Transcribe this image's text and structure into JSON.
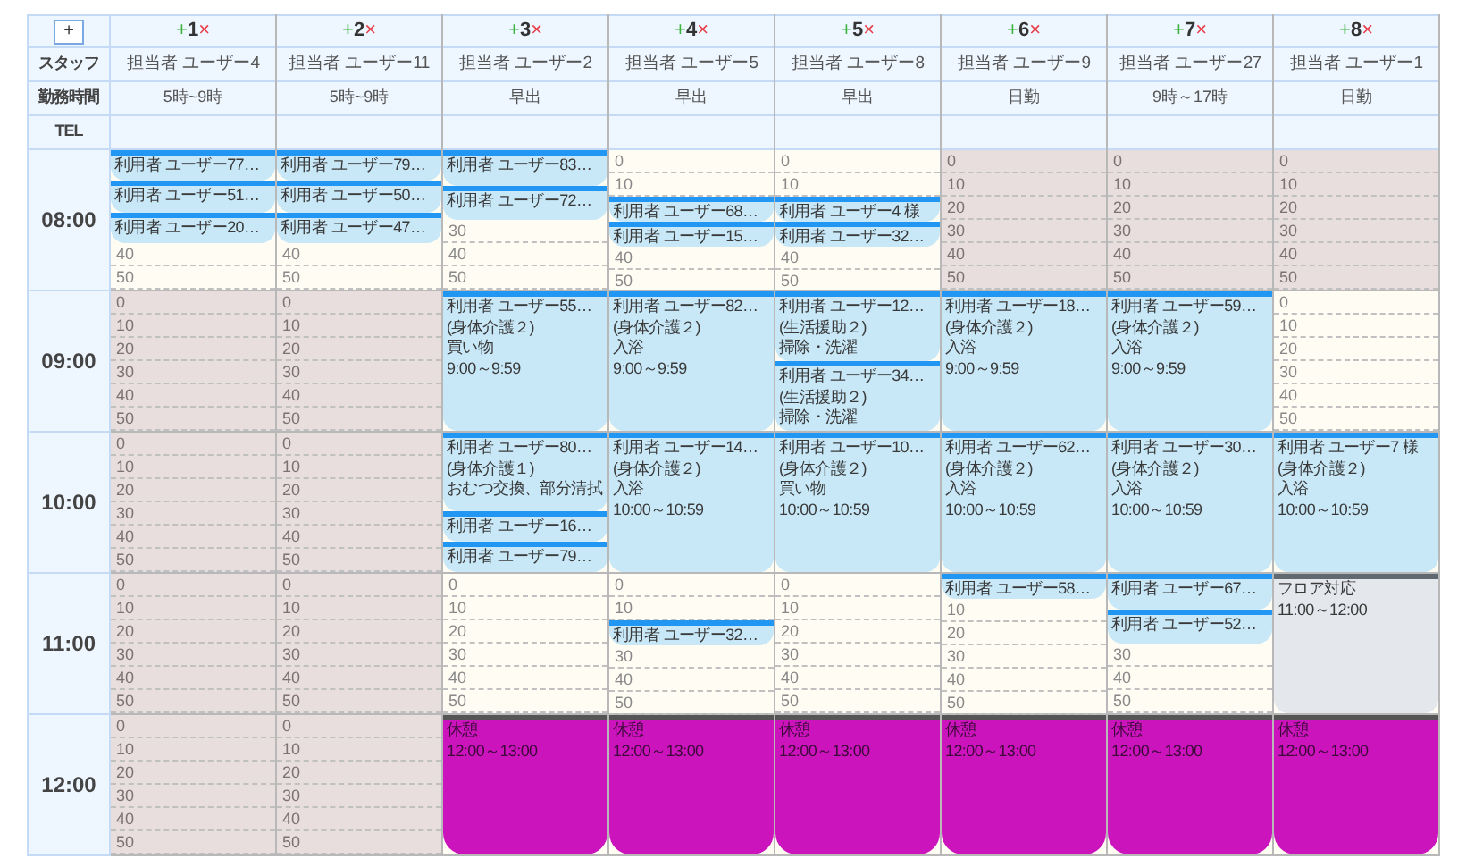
{
  "corner": {
    "add": "+",
    "labels": [
      "スタッフ",
      "勤務時間",
      "TEL"
    ]
  },
  "hours": [
    "08:00",
    "09:00",
    "10:00",
    "11:00",
    "12:00"
  ],
  "columns": [
    {
      "add": "+",
      "number": "1",
      "remove": "×",
      "staff": "担当者 ユーザー4",
      "shift": "5時~9時",
      "hours": [
        {
          "shaded": false,
          "items": [
            {
              "kind": "visit",
              "lines": [
                "利用者 ユーザー77…"
              ]
            },
            {
              "kind": "visit",
              "lines": [
                "利用者 ユーザー51…"
              ]
            },
            {
              "kind": "visit",
              "lines": [
                "利用者 ユーザー20…"
              ]
            },
            {
              "kind": "slot",
              "label": "40"
            },
            {
              "kind": "slot",
              "label": "50"
            }
          ]
        },
        {
          "shaded": true,
          "items": [
            {
              "kind": "slot",
              "label": "0"
            },
            {
              "kind": "slot",
              "label": "10"
            },
            {
              "kind": "slot",
              "label": "20"
            },
            {
              "kind": "slot",
              "label": "30"
            },
            {
              "kind": "slot",
              "label": "40"
            },
            {
              "kind": "slot",
              "label": "50"
            }
          ]
        },
        {
          "shaded": true,
          "items": [
            {
              "kind": "slot",
              "label": "0"
            },
            {
              "kind": "slot",
              "label": "10"
            },
            {
              "kind": "slot",
              "label": "20"
            },
            {
              "kind": "slot",
              "label": "30"
            },
            {
              "kind": "slot",
              "label": "40"
            },
            {
              "kind": "slot",
              "label": "50"
            }
          ]
        },
        {
          "shaded": true,
          "items": [
            {
              "kind": "slot",
              "label": "0"
            },
            {
              "kind": "slot",
              "label": "10"
            },
            {
              "kind": "slot",
              "label": "20"
            },
            {
              "kind": "slot",
              "label": "30"
            },
            {
              "kind": "slot",
              "label": "40"
            },
            {
              "kind": "slot",
              "label": "50"
            }
          ]
        },
        {
          "shaded": true,
          "items": [
            {
              "kind": "slot",
              "label": "0"
            },
            {
              "kind": "slot",
              "label": "10"
            },
            {
              "kind": "slot",
              "label": "20"
            },
            {
              "kind": "slot",
              "label": "30"
            },
            {
              "kind": "slot",
              "label": "40"
            },
            {
              "kind": "slot",
              "label": "50"
            }
          ]
        }
      ]
    },
    {
      "add": "+",
      "number": "2",
      "remove": "×",
      "staff": "担当者 ユーザー11",
      "shift": "5時~9時",
      "hours": [
        {
          "shaded": false,
          "items": [
            {
              "kind": "visit",
              "lines": [
                "利用者 ユーザー79…"
              ]
            },
            {
              "kind": "visit",
              "lines": [
                "利用者 ユーザー50…"
              ]
            },
            {
              "kind": "visit",
              "lines": [
                "利用者 ユーザー47…"
              ]
            },
            {
              "kind": "slot",
              "label": "40"
            },
            {
              "kind": "slot",
              "label": "50"
            }
          ]
        },
        {
          "shaded": true,
          "items": [
            {
              "kind": "slot",
              "label": "0"
            },
            {
              "kind": "slot",
              "label": "10"
            },
            {
              "kind": "slot",
              "label": "20"
            },
            {
              "kind": "slot",
              "label": "30"
            },
            {
              "kind": "slot",
              "label": "40"
            },
            {
              "kind": "slot",
              "label": "50"
            }
          ]
        },
        {
          "shaded": true,
          "items": [
            {
              "kind": "slot",
              "label": "0"
            },
            {
              "kind": "slot",
              "label": "10"
            },
            {
              "kind": "slot",
              "label": "20"
            },
            {
              "kind": "slot",
              "label": "30"
            },
            {
              "kind": "slot",
              "label": "40"
            },
            {
              "kind": "slot",
              "label": "50"
            }
          ]
        },
        {
          "shaded": true,
          "items": [
            {
              "kind": "slot",
              "label": "0"
            },
            {
              "kind": "slot",
              "label": "10"
            },
            {
              "kind": "slot",
              "label": "20"
            },
            {
              "kind": "slot",
              "label": "30"
            },
            {
              "kind": "slot",
              "label": "40"
            },
            {
              "kind": "slot",
              "label": "50"
            }
          ]
        },
        {
          "shaded": true,
          "items": [
            {
              "kind": "slot",
              "label": "0"
            },
            {
              "kind": "slot",
              "label": "10"
            },
            {
              "kind": "slot",
              "label": "20"
            },
            {
              "kind": "slot",
              "label": "30"
            },
            {
              "kind": "slot",
              "label": "40"
            },
            {
              "kind": "slot",
              "label": "50"
            }
          ]
        }
      ]
    },
    {
      "add": "+",
      "number": "3",
      "remove": "×",
      "staff": "担当者 ユーザー2",
      "shift": "早出",
      "hours": [
        {
          "shaded": false,
          "items": [
            {
              "kind": "visit",
              "lines": [
                "利用者 ユーザー83…"
              ]
            },
            {
              "kind": "visit",
              "lines": [
                "利用者 ユーザー72…"
              ]
            },
            {
              "kind": "slot",
              "label": "30"
            },
            {
              "kind": "slot",
              "label": "40"
            },
            {
              "kind": "slot",
              "label": "50"
            }
          ]
        },
        {
          "shaded": false,
          "items": [
            {
              "kind": "visit",
              "lines": [
                "利用者 ユーザー55…",
                "(身体介護２)",
                "買い物",
                "9:00～9:59"
              ]
            }
          ]
        },
        {
          "shaded": false,
          "items": [
            {
              "kind": "visit",
              "lines": [
                "利用者 ユーザー80…",
                "(身体介護１)",
                "おむつ交換、部分清拭"
              ]
            },
            {
              "kind": "visit",
              "lines": [
                "利用者 ユーザー16…"
              ]
            },
            {
              "kind": "visit",
              "lines": [
                "利用者 ユーザー79…"
              ]
            }
          ]
        },
        {
          "shaded": false,
          "items": [
            {
              "kind": "slot",
              "label": "0"
            },
            {
              "kind": "slot",
              "label": "10"
            },
            {
              "kind": "slot",
              "label": "20"
            },
            {
              "kind": "slot",
              "label": "30"
            },
            {
              "kind": "slot",
              "label": "40"
            },
            {
              "kind": "slot",
              "label": "50"
            }
          ]
        },
        {
          "shaded": false,
          "items": [
            {
              "kind": "break",
              "lines": [
                "休憩",
                "12:00～13:00"
              ]
            }
          ]
        }
      ]
    },
    {
      "add": "+",
      "number": "4",
      "remove": "×",
      "staff": "担当者 ユーザー5",
      "shift": "早出",
      "hours": [
        {
          "shaded": false,
          "items": [
            {
              "kind": "slot",
              "label": "0"
            },
            {
              "kind": "slot",
              "label": "10"
            },
            {
              "kind": "visit",
              "lines": [
                "利用者 ユーザー68…"
              ]
            },
            {
              "kind": "visit",
              "lines": [
                "利用者 ユーザー15…"
              ]
            },
            {
              "kind": "slot",
              "label": "40"
            },
            {
              "kind": "slot",
              "label": "50"
            }
          ]
        },
        {
          "shaded": false,
          "items": [
            {
              "kind": "visit",
              "lines": [
                "利用者 ユーザー82…",
                "(身体介護２)",
                "入浴",
                "9:00～9:59"
              ]
            }
          ]
        },
        {
          "shaded": false,
          "items": [
            {
              "kind": "visit",
              "lines": [
                "利用者 ユーザー14…",
                "(身体介護２)",
                "入浴",
                "10:00～10:59"
              ]
            }
          ]
        },
        {
          "shaded": false,
          "items": [
            {
              "kind": "slot",
              "label": "0"
            },
            {
              "kind": "slot",
              "label": "10"
            },
            {
              "kind": "visit",
              "lines": [
                "利用者 ユーザー32…"
              ]
            },
            {
              "kind": "slot",
              "label": "30"
            },
            {
              "kind": "slot",
              "label": "40"
            },
            {
              "kind": "slot",
              "label": "50"
            }
          ]
        },
        {
          "shaded": false,
          "items": [
            {
              "kind": "break",
              "lines": [
                "休憩",
                "12:00～13:00"
              ]
            }
          ]
        }
      ]
    },
    {
      "add": "+",
      "number": "5",
      "remove": "×",
      "staff": "担当者 ユーザー8",
      "shift": "早出",
      "hours": [
        {
          "shaded": false,
          "items": [
            {
              "kind": "slot",
              "label": "0"
            },
            {
              "kind": "slot",
              "label": "10"
            },
            {
              "kind": "visit",
              "lines": [
                "利用者 ユーザー4 様"
              ]
            },
            {
              "kind": "visit",
              "lines": [
                "利用者 ユーザー32…"
              ]
            },
            {
              "kind": "slot",
              "label": "40"
            },
            {
              "kind": "slot",
              "label": "50"
            }
          ]
        },
        {
          "shaded": false,
          "items": [
            {
              "kind": "visit",
              "lines": [
                "利用者 ユーザー12…",
                "(生活援助２)",
                "掃除・洗濯"
              ]
            },
            {
              "kind": "visit",
              "lines": [
                "利用者 ユーザー34…",
                "(生活援助２)",
                "掃除・洗濯"
              ]
            }
          ]
        },
        {
          "shaded": false,
          "items": [
            {
              "kind": "visit",
              "lines": [
                "利用者 ユーザー10…",
                "(身体介護２)",
                "買い物",
                "10:00～10:59"
              ]
            }
          ]
        },
        {
          "shaded": false,
          "items": [
            {
              "kind": "slot",
              "label": "0"
            },
            {
              "kind": "slot",
              "label": "10"
            },
            {
              "kind": "slot",
              "label": "20"
            },
            {
              "kind": "slot",
              "label": "30"
            },
            {
              "kind": "slot",
              "label": "40"
            },
            {
              "kind": "slot",
              "label": "50"
            }
          ]
        },
        {
          "shaded": false,
          "items": [
            {
              "kind": "break",
              "lines": [
                "休憩",
                "12:00～13:00"
              ]
            }
          ]
        }
      ]
    },
    {
      "add": "+",
      "number": "6",
      "remove": "×",
      "staff": "担当者 ユーザー9",
      "shift": "日勤",
      "hours": [
        {
          "shaded": true,
          "items": [
            {
              "kind": "slot",
              "label": "0"
            },
            {
              "kind": "slot",
              "label": "10"
            },
            {
              "kind": "slot",
              "label": "20"
            },
            {
              "kind": "slot",
              "label": "30"
            },
            {
              "kind": "slot",
              "label": "40"
            },
            {
              "kind": "slot",
              "label": "50"
            }
          ]
        },
        {
          "shaded": false,
          "items": [
            {
              "kind": "visit",
              "lines": [
                "利用者 ユーザー18…",
                "(身体介護２)",
                "入浴",
                "9:00～9:59"
              ]
            }
          ]
        },
        {
          "shaded": false,
          "items": [
            {
              "kind": "visit",
              "lines": [
                "利用者 ユーザー62…",
                "(身体介護２)",
                "入浴",
                "10:00～10:59"
              ]
            }
          ]
        },
        {
          "shaded": false,
          "items": [
            {
              "kind": "visit",
              "lines": [
                "利用者 ユーザー58…"
              ]
            },
            {
              "kind": "slot",
              "label": "10"
            },
            {
              "kind": "slot",
              "label": "20"
            },
            {
              "kind": "slot",
              "label": "30"
            },
            {
              "kind": "slot",
              "label": "40"
            },
            {
              "kind": "slot",
              "label": "50"
            }
          ]
        },
        {
          "shaded": false,
          "items": [
            {
              "kind": "break",
              "lines": [
                "休憩",
                "12:00～13:00"
              ]
            }
          ]
        }
      ]
    },
    {
      "add": "+",
      "number": "7",
      "remove": "×",
      "staff": "担当者 ユーザー27",
      "shift": "9時～17時",
      "hours": [
        {
          "shaded": true,
          "items": [
            {
              "kind": "slot",
              "label": "0"
            },
            {
              "kind": "slot",
              "label": "10"
            },
            {
              "kind": "slot",
              "label": "20"
            },
            {
              "kind": "slot",
              "label": "30"
            },
            {
              "kind": "slot",
              "label": "40"
            },
            {
              "kind": "slot",
              "label": "50"
            }
          ]
        },
        {
          "shaded": false,
          "items": [
            {
              "kind": "visit",
              "lines": [
                "利用者 ユーザー59…",
                "(身体介護２)",
                "入浴",
                "9:00～9:59"
              ]
            }
          ]
        },
        {
          "shaded": false,
          "items": [
            {
              "kind": "visit",
              "lines": [
                "利用者 ユーザー30…",
                "(身体介護２)",
                "入浴",
                "10:00～10:59"
              ]
            }
          ]
        },
        {
          "shaded": false,
          "items": [
            {
              "kind": "visit",
              "lines": [
                "利用者 ユーザー67…"
              ]
            },
            {
              "kind": "visit",
              "lines": [
                "利用者 ユーザー52…"
              ]
            },
            {
              "kind": "slot",
              "label": "30"
            },
            {
              "kind": "slot",
              "label": "40"
            },
            {
              "kind": "slot",
              "label": "50"
            }
          ]
        },
        {
          "shaded": false,
          "items": [
            {
              "kind": "break",
              "lines": [
                "休憩",
                "12:00～13:00"
              ]
            }
          ]
        }
      ]
    },
    {
      "add": "+",
      "number": "8",
      "remove": "×",
      "staff": "担当者 ユーザー1",
      "shift": "日勤",
      "hours": [
        {
          "shaded": true,
          "items": [
            {
              "kind": "slot",
              "label": "0"
            },
            {
              "kind": "slot",
              "label": "10"
            },
            {
              "kind": "slot",
              "label": "20"
            },
            {
              "kind": "slot",
              "label": "30"
            },
            {
              "kind": "slot",
              "label": "40"
            },
            {
              "kind": "slot",
              "label": "50"
            }
          ]
        },
        {
          "shaded": false,
          "items": [
            {
              "kind": "slot",
              "label": "0"
            },
            {
              "kind": "slot",
              "label": "10"
            },
            {
              "kind": "slot",
              "label": "20"
            },
            {
              "kind": "slot",
              "label": "30"
            },
            {
              "kind": "slot",
              "label": "40"
            },
            {
              "kind": "slot",
              "label": "50"
            }
          ]
        },
        {
          "shaded": false,
          "items": [
            {
              "kind": "visit",
              "lines": [
                "利用者 ユーザー7 様",
                "(身体介護２)",
                "入浴",
                "10:00～10:59"
              ]
            }
          ]
        },
        {
          "shaded": false,
          "items": [
            {
              "kind": "task",
              "lines": [
                "フロア対応",
                "11:00～12:00"
              ]
            }
          ]
        },
        {
          "shaded": false,
          "items": [
            {
              "kind": "break",
              "lines": [
                "休憩",
                "12:00～13:00"
              ]
            }
          ]
        }
      ]
    }
  ]
}
